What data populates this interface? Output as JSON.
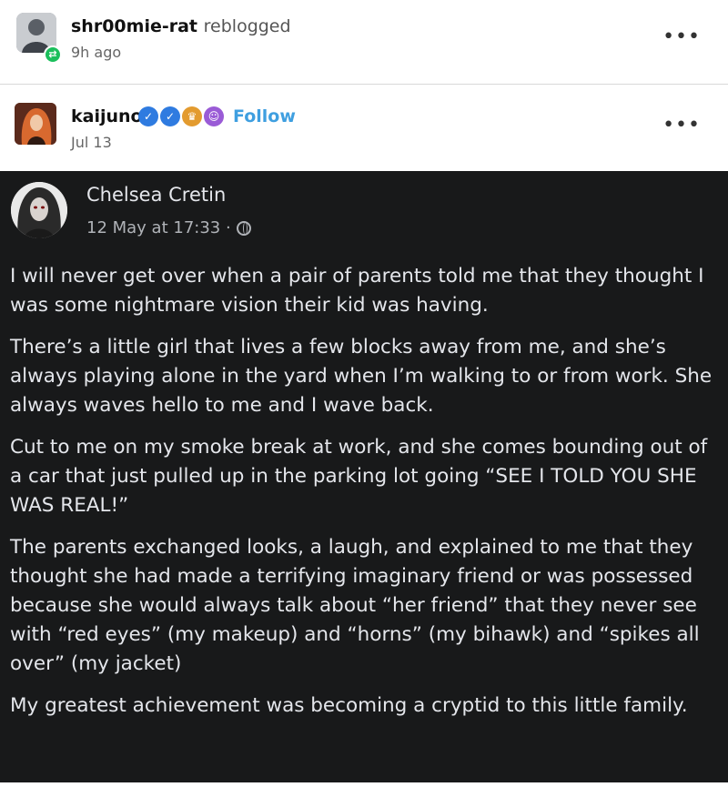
{
  "reblog": {
    "username": "shr00mie-rat",
    "action": "reblogged",
    "time": "9h ago"
  },
  "post": {
    "author": "kaijuno",
    "follow_label": "Follow",
    "date": "Jul 13",
    "badges": [
      "verified-badge",
      "verified-badge",
      "crown-badge",
      "alien-badge"
    ]
  },
  "fb": {
    "name": "Chelsea Cretin",
    "timestamp": "12 May at 17:33 ·",
    "paragraphs": [
      "I will never get over when a pair of parents told me that they thought I was some nightmare vision their kid was having.",
      "There’s a little girl that lives a few blocks away from me, and she’s always playing alone in the yard when I’m walking to or from work. She always waves hello to me and I wave back.",
      "Cut to me on my smoke break at work, and she comes bounding out of a car that just pulled up in the parking lot going “SEE I TOLD YOU SHE WAS REAL!”",
      "The parents exchanged looks, a laugh, and explained to me that they thought she had made a terrifying imaginary friend or was possessed because she would always talk about “her friend” that they never see with “red eyes” (my makeup) and “horns” (my bihawk) and “spikes all over” (my jacket)",
      "My greatest achievement was becoming a cryptid to this little family."
    ]
  },
  "more_label": "•••",
  "reblog_icon": "⇄",
  "colors": {
    "follow": "#3f9fe0",
    "fb_bg": "#18191a",
    "reblog_badge": "#1bbf5c"
  }
}
